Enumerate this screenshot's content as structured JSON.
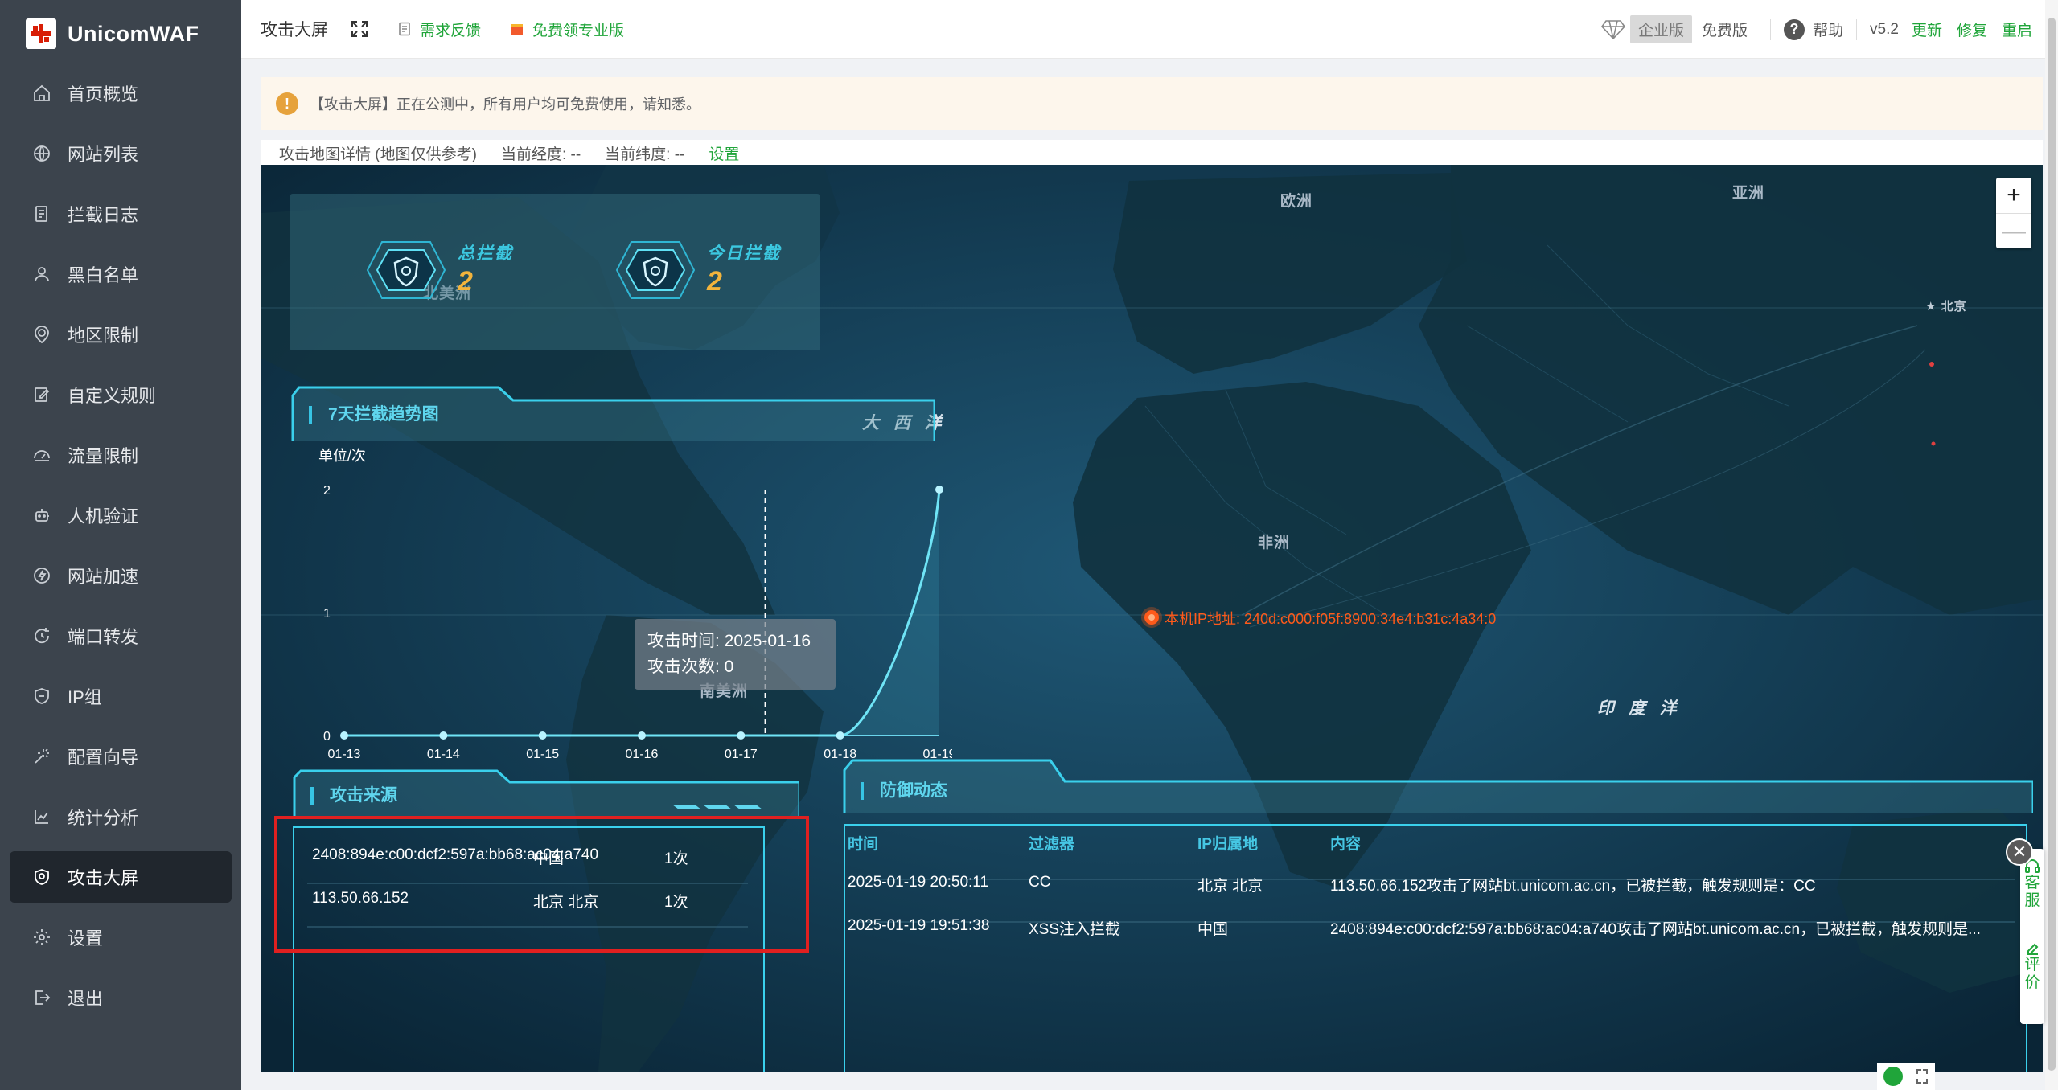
{
  "brand": {
    "name": "UnicomWAF"
  },
  "sidebar": {
    "items": [
      {
        "label": "首页概览",
        "icon": "home-icon"
      },
      {
        "label": "网站列表",
        "icon": "globe-icon"
      },
      {
        "label": "拦截日志",
        "icon": "log-icon"
      },
      {
        "label": "黑白名单",
        "icon": "user-icon"
      },
      {
        "label": "地区限制",
        "icon": "location-icon"
      },
      {
        "label": "自定义规则",
        "icon": "edit-icon"
      },
      {
        "label": "流量限制",
        "icon": "gauge-icon"
      },
      {
        "label": "人机验证",
        "icon": "robot-icon"
      },
      {
        "label": "网站加速",
        "icon": "lightning-icon"
      },
      {
        "label": "端口转发",
        "icon": "redirect-icon"
      },
      {
        "label": "IP组",
        "icon": "shield-icon"
      },
      {
        "label": "配置向导",
        "icon": "wizard-icon"
      },
      {
        "label": "统计分析",
        "icon": "chart-icon"
      },
      {
        "label": "攻击大屏",
        "icon": "shield-screen-icon",
        "active": true
      },
      {
        "label": "设置",
        "icon": "gear-icon"
      },
      {
        "label": "退出",
        "icon": "logout-icon"
      }
    ]
  },
  "topbar": {
    "title": "攻击大屏",
    "feedback": "需求反馈",
    "free_pro": "免费领专业版",
    "edition_enterprise": "企业版",
    "edition_free": "免费版",
    "help": "帮助",
    "version": "v5.2",
    "update": "更新",
    "repair": "修复",
    "restart": "重启"
  },
  "notice": {
    "text": "【攻击大屏】正在公测中，所有用户均可免费使用，请知悉。"
  },
  "map_header": {
    "title": "攻击地图详情 (地图仅供参考)",
    "longitude": "当前经度: --",
    "latitude": "当前纬度: --",
    "settings": "设置"
  },
  "map": {
    "labels": {
      "europe": "欧洲",
      "asia": "亚洲",
      "africa": "非洲",
      "north_america": "北美洲",
      "south_america": "南美洲",
      "atlantic": "大 西 洋",
      "indian": "印 度 洋",
      "beijing": "北京"
    },
    "local_ip": "本机IP地址: 240d:c000:f05f:8900:34e4:b31c:4a34:0",
    "zoom_in": "+",
    "zoom_out": "—"
  },
  "stats": {
    "total_label": "总拦截",
    "total_value": "2",
    "today_label": "今日拦截",
    "today_value": "2"
  },
  "trend": {
    "title": "7天拦截趋势图",
    "unit": "单位/次",
    "tooltip_time": "攻击时间: 2025-01-16",
    "tooltip_count": "攻击次数: 0"
  },
  "chart_data": {
    "type": "line",
    "title": "7天拦截趋势图",
    "ylabel": "单位/次",
    "categories": [
      "01-13",
      "01-14",
      "01-15",
      "01-16",
      "01-17",
      "01-18",
      "01-19"
    ],
    "values": [
      0,
      0,
      0,
      0,
      0,
      0,
      2
    ],
    "ylim": [
      0,
      2
    ],
    "yticks": [
      "0",
      "1",
      "2"
    ]
  },
  "sources": {
    "title": "攻击来源",
    "rows": [
      {
        "ip": "2408:894e:c00:dcf2:597a:bb68:ac04:a740",
        "region": "中国",
        "count": "1次"
      },
      {
        "ip": "113.50.66.152",
        "region": "北京 北京",
        "count": "1次"
      }
    ]
  },
  "defense": {
    "title": "防御动态",
    "headers": [
      "时间",
      "过滤器",
      "IP归属地",
      "内容"
    ],
    "rows": [
      {
        "time": "2025-01-19 20:50:11",
        "filter": "CC",
        "location": "北京 北京",
        "content": "113.50.66.152攻击了网站bt.unicom.ac.cn，已被拦截，触发规则是：CC"
      },
      {
        "time": "2025-01-19 19:51:38",
        "filter": "XSS注入拦截",
        "location": "中国",
        "content": "2408:894e:c00:dcf2:597a:bb68:ac04:a740攻击了网站bt.unicom.ac.cn，已被拦截，触发规则是..."
      }
    ]
  },
  "float": {
    "service": "客服",
    "review": "评价",
    "close": "✕"
  },
  "colors": {
    "accent": "#20a53a",
    "sidebar": "#3c444d",
    "map_bg": "#0b2a3d",
    "cyan": "#46c7e4",
    "gold": "#f2b43c"
  }
}
